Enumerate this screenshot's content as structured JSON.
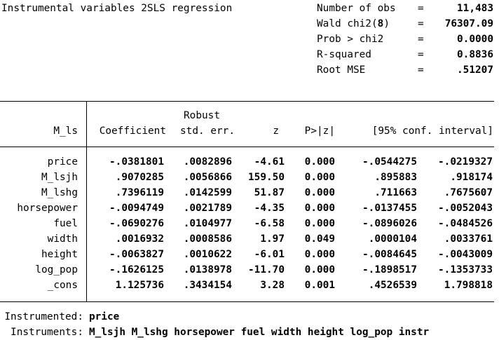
{
  "title": "Instrumental variables 2SLS regression",
  "stats": [
    {
      "label": "Number of obs",
      "eq": "=",
      "value": "11,483"
    },
    {
      "label": "Wald chi2(8)",
      "eq": "=",
      "value": "76307.09"
    },
    {
      "label": "Prob > chi2",
      "eq": "=",
      "value": "0.0000"
    },
    {
      "label": "R-squared",
      "eq": "=",
      "value": "0.8836"
    },
    {
      "label": "Root MSE",
      "eq": "=",
      "value": ".51207"
    }
  ],
  "table": {
    "depvar": "M_ls",
    "robust_label": "Robust",
    "headers": [
      "Coefficient",
      "std. err.",
      "z",
      "P>|z|",
      "[95% conf. interval]"
    ],
    "rows": [
      {
        "name": "price",
        "values": [
          "-.0381801",
          ".0082896",
          "-4.61",
          "0.000",
          "-.0544275",
          "-.0219327"
        ]
      },
      {
        "name": "M_lsjh",
        "values": [
          ".9070285",
          ".0056866",
          "159.50",
          "0.000",
          ".895883",
          ".918174"
        ]
      },
      {
        "name": "M_lshg",
        "values": [
          ".7396119",
          ".0142599",
          "51.87",
          "0.000",
          ".711663",
          ".7675607"
        ]
      },
      {
        "name": "horsepower",
        "values": [
          "-.0094749",
          ".0021789",
          "-4.35",
          "0.000",
          "-.0137455",
          "-.0052043"
        ]
      },
      {
        "name": "fuel",
        "values": [
          "-.0690276",
          ".0104977",
          "-6.58",
          "0.000",
          "-.0896026",
          "-.0484526"
        ]
      },
      {
        "name": "width",
        "values": [
          ".0016932",
          ".0008586",
          "1.97",
          "0.049",
          ".0000104",
          ".0033761"
        ]
      },
      {
        "name": "height",
        "values": [
          "-.0063827",
          ".0010622",
          "-6.01",
          "0.000",
          "-.0084645",
          "-.0043009"
        ]
      },
      {
        "name": "log_pop",
        "values": [
          "-.1626125",
          ".0138978",
          "-11.70",
          "0.000",
          "-.1898517",
          "-.1353733"
        ]
      },
      {
        "name": "_cons",
        "values": [
          "1.125736",
          ".3434154",
          "3.28",
          "0.001",
          ".4526539",
          "1.798818"
        ]
      }
    ]
  },
  "footer": {
    "instrumented_label": "Instrumented:",
    "instrumented_value": "price",
    "instruments_label": "Instruments:",
    "instruments_value": "M_lsjh M_lshg horsepower fuel width height log_pop instr"
  }
}
